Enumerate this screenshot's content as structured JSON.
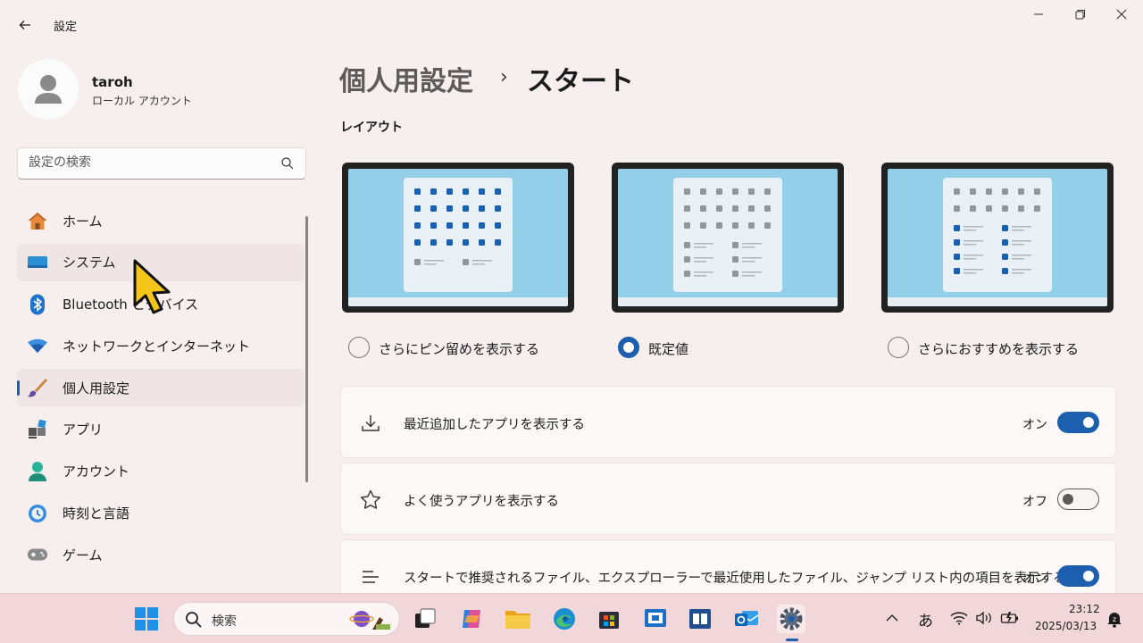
{
  "window": {
    "title": "設定"
  },
  "profile": {
    "name": "taroh",
    "account_type": "ローカル アカウント"
  },
  "search": {
    "placeholder": "設定の検索"
  },
  "nav": {
    "items": [
      {
        "label": "ホーム",
        "icon": "home-icon"
      },
      {
        "label": "システム",
        "icon": "system-icon"
      },
      {
        "label": "Bluetooth とデバイス",
        "icon": "bluetooth-icon"
      },
      {
        "label": "ネットワークとインターネット",
        "icon": "wifi-icon"
      },
      {
        "label": "個人用設定",
        "icon": "brush-icon",
        "selected": true
      },
      {
        "label": "アプリ",
        "icon": "apps-icon"
      },
      {
        "label": "アカウント",
        "icon": "account-icon"
      },
      {
        "label": "時刻と言語",
        "icon": "clock-globe-icon"
      },
      {
        "label": "ゲーム",
        "icon": "gamepad-icon"
      }
    ]
  },
  "header": {
    "parent": "個人用設定",
    "separator": "›",
    "current": "スタート"
  },
  "layout_section": {
    "title": "レイアウト",
    "options": [
      {
        "label": "さらにピン留めを表示する",
        "checked": false
      },
      {
        "label": "既定値",
        "checked": true
      },
      {
        "label": "さらにおすすめを表示する",
        "checked": false
      }
    ]
  },
  "settings": [
    {
      "label": "最近追加したアプリを表示する",
      "state": "オン",
      "on": true,
      "icon": "download-icon"
    },
    {
      "label": "よく使うアプリを表示する",
      "state": "オフ",
      "on": false,
      "icon": "star-icon"
    },
    {
      "label": "スタートで推奨されるファイル、エクスプローラーで最近使用したファイル、ジャンプ リスト内の項目を表示する",
      "state": "オン",
      "on": true,
      "icon": "list-icon"
    }
  ],
  "taskbar": {
    "search_placeholder": "検索",
    "ime": "あ",
    "time": "23:12",
    "date": "2025/03/13"
  },
  "colors": {
    "accent": "#1c5fae",
    "background": "#f7eeee",
    "taskbar": "#f1d7d9"
  }
}
